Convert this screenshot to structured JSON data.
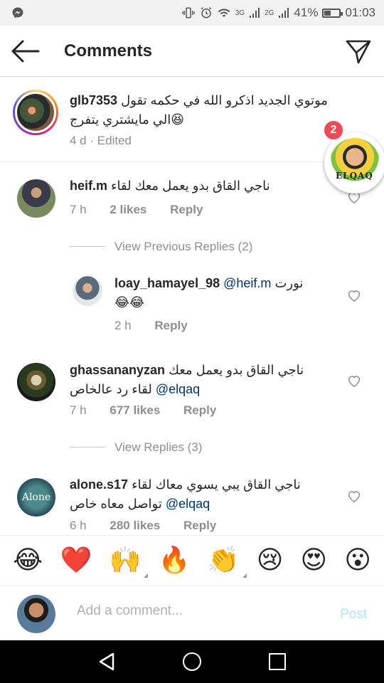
{
  "status_bar": {
    "network_3g": "3G",
    "network_2g": "2G",
    "battery": "41%",
    "time": "01:03"
  },
  "header": {
    "title": "Comments"
  },
  "caption": {
    "username": "glb7353",
    "text": "موتوي الجديد اذكرو الله في حكمه تقول الي مايشتري يتفرج😆",
    "time": "4 d",
    "separator": "·",
    "edited": "Edited"
  },
  "chat_head": {
    "badge": "2",
    "label": "ELQAQ"
  },
  "comments": [
    {
      "username": "heif.m",
      "text": "ناجي القاق بدو يعمل معك لقاء",
      "mention": "",
      "time": "7 h",
      "likes": "2 likes",
      "reply": "Reply"
    },
    {
      "username": "ghassananyzan",
      "text": "ناجي القاق بدو يعمل معك لقاء رد عالخاص",
      "mention": "@elqaq",
      "time": "7 h",
      "likes": "677 likes",
      "reply": "Reply"
    },
    {
      "username": "alone.s17",
      "text": "ناجي القاق يبي يسوي معاك لقاء تواصل معاه خاص",
      "mention": "@elqaq",
      "time": "6 h",
      "likes": "280 likes",
      "reply": "Reply"
    }
  ],
  "view_previous": "View Previous Replies (2)",
  "reply": {
    "username": "loay_hamayel_98",
    "mention": "@heif.m",
    "text": "نورت",
    "emoji": "😂😂",
    "time": "2 h",
    "reply_label": "Reply"
  },
  "view_replies": "View Replies (3)",
  "avatar_alone_text": "Alone",
  "emoji_bar": [
    "😂",
    "❤️",
    "🙌",
    "🔥",
    "👏",
    "😢",
    "😍",
    "😮"
  ],
  "input": {
    "placeholder": "Add a comment...",
    "post": "Post"
  },
  "colors": {
    "mention": "#003569",
    "meta_gray": "#8e8e8e",
    "post_disabled": "#b2dffc",
    "badge": "#ed4956"
  }
}
